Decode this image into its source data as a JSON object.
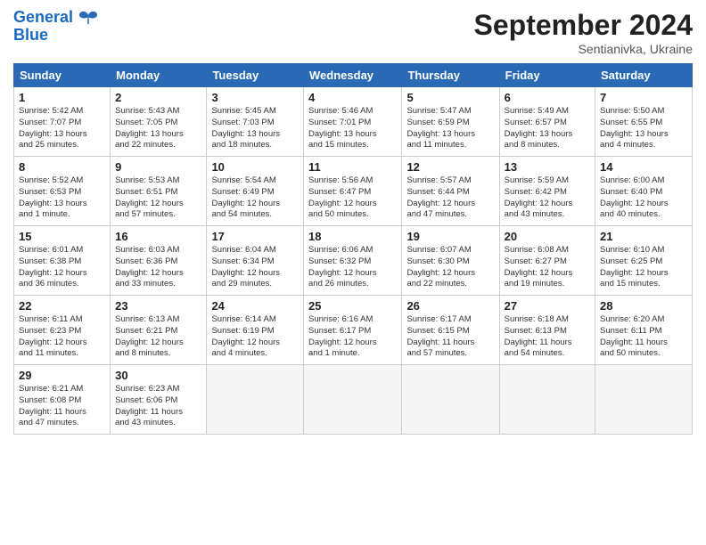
{
  "header": {
    "logo_line1": "General",
    "logo_line2": "Blue",
    "month_title": "September 2024",
    "location": "Sentianivka, Ukraine"
  },
  "weekdays": [
    "Sunday",
    "Monday",
    "Tuesday",
    "Wednesday",
    "Thursday",
    "Friday",
    "Saturday"
  ],
  "weeks": [
    [
      {
        "day": "1",
        "info": "Sunrise: 5:42 AM\nSunset: 7:07 PM\nDaylight: 13 hours\nand 25 minutes."
      },
      {
        "day": "2",
        "info": "Sunrise: 5:43 AM\nSunset: 7:05 PM\nDaylight: 13 hours\nand 22 minutes."
      },
      {
        "day": "3",
        "info": "Sunrise: 5:45 AM\nSunset: 7:03 PM\nDaylight: 13 hours\nand 18 minutes."
      },
      {
        "day": "4",
        "info": "Sunrise: 5:46 AM\nSunset: 7:01 PM\nDaylight: 13 hours\nand 15 minutes."
      },
      {
        "day": "5",
        "info": "Sunrise: 5:47 AM\nSunset: 6:59 PM\nDaylight: 13 hours\nand 11 minutes."
      },
      {
        "day": "6",
        "info": "Sunrise: 5:49 AM\nSunset: 6:57 PM\nDaylight: 13 hours\nand 8 minutes."
      },
      {
        "day": "7",
        "info": "Sunrise: 5:50 AM\nSunset: 6:55 PM\nDaylight: 13 hours\nand 4 minutes."
      }
    ],
    [
      {
        "day": "8",
        "info": "Sunrise: 5:52 AM\nSunset: 6:53 PM\nDaylight: 13 hours\nand 1 minute."
      },
      {
        "day": "9",
        "info": "Sunrise: 5:53 AM\nSunset: 6:51 PM\nDaylight: 12 hours\nand 57 minutes."
      },
      {
        "day": "10",
        "info": "Sunrise: 5:54 AM\nSunset: 6:49 PM\nDaylight: 12 hours\nand 54 minutes."
      },
      {
        "day": "11",
        "info": "Sunrise: 5:56 AM\nSunset: 6:47 PM\nDaylight: 12 hours\nand 50 minutes."
      },
      {
        "day": "12",
        "info": "Sunrise: 5:57 AM\nSunset: 6:44 PM\nDaylight: 12 hours\nand 47 minutes."
      },
      {
        "day": "13",
        "info": "Sunrise: 5:59 AM\nSunset: 6:42 PM\nDaylight: 12 hours\nand 43 minutes."
      },
      {
        "day": "14",
        "info": "Sunrise: 6:00 AM\nSunset: 6:40 PM\nDaylight: 12 hours\nand 40 minutes."
      }
    ],
    [
      {
        "day": "15",
        "info": "Sunrise: 6:01 AM\nSunset: 6:38 PM\nDaylight: 12 hours\nand 36 minutes."
      },
      {
        "day": "16",
        "info": "Sunrise: 6:03 AM\nSunset: 6:36 PM\nDaylight: 12 hours\nand 33 minutes."
      },
      {
        "day": "17",
        "info": "Sunrise: 6:04 AM\nSunset: 6:34 PM\nDaylight: 12 hours\nand 29 minutes."
      },
      {
        "day": "18",
        "info": "Sunrise: 6:06 AM\nSunset: 6:32 PM\nDaylight: 12 hours\nand 26 minutes."
      },
      {
        "day": "19",
        "info": "Sunrise: 6:07 AM\nSunset: 6:30 PM\nDaylight: 12 hours\nand 22 minutes."
      },
      {
        "day": "20",
        "info": "Sunrise: 6:08 AM\nSunset: 6:27 PM\nDaylight: 12 hours\nand 19 minutes."
      },
      {
        "day": "21",
        "info": "Sunrise: 6:10 AM\nSunset: 6:25 PM\nDaylight: 12 hours\nand 15 minutes."
      }
    ],
    [
      {
        "day": "22",
        "info": "Sunrise: 6:11 AM\nSunset: 6:23 PM\nDaylight: 12 hours\nand 11 minutes."
      },
      {
        "day": "23",
        "info": "Sunrise: 6:13 AM\nSunset: 6:21 PM\nDaylight: 12 hours\nand 8 minutes."
      },
      {
        "day": "24",
        "info": "Sunrise: 6:14 AM\nSunset: 6:19 PM\nDaylight: 12 hours\nand 4 minutes."
      },
      {
        "day": "25",
        "info": "Sunrise: 6:16 AM\nSunset: 6:17 PM\nDaylight: 12 hours\nand 1 minute."
      },
      {
        "day": "26",
        "info": "Sunrise: 6:17 AM\nSunset: 6:15 PM\nDaylight: 11 hours\nand 57 minutes."
      },
      {
        "day": "27",
        "info": "Sunrise: 6:18 AM\nSunset: 6:13 PM\nDaylight: 11 hours\nand 54 minutes."
      },
      {
        "day": "28",
        "info": "Sunrise: 6:20 AM\nSunset: 6:11 PM\nDaylight: 11 hours\nand 50 minutes."
      }
    ],
    [
      {
        "day": "29",
        "info": "Sunrise: 6:21 AM\nSunset: 6:08 PM\nDaylight: 11 hours\nand 47 minutes."
      },
      {
        "day": "30",
        "info": "Sunrise: 6:23 AM\nSunset: 6:06 PM\nDaylight: 11 hours\nand 43 minutes."
      },
      {
        "day": "",
        "info": ""
      },
      {
        "day": "",
        "info": ""
      },
      {
        "day": "",
        "info": ""
      },
      {
        "day": "",
        "info": ""
      },
      {
        "day": "",
        "info": ""
      }
    ]
  ]
}
